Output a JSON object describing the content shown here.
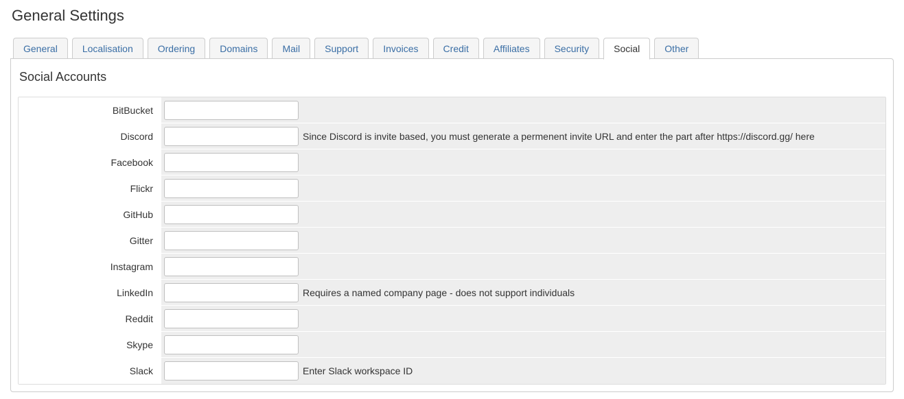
{
  "page_title": "General Settings",
  "tabs": [
    {
      "key": "general",
      "label": "General",
      "active": false
    },
    {
      "key": "localisation",
      "label": "Localisation",
      "active": false
    },
    {
      "key": "ordering",
      "label": "Ordering",
      "active": false
    },
    {
      "key": "domains",
      "label": "Domains",
      "active": false
    },
    {
      "key": "mail",
      "label": "Mail",
      "active": false
    },
    {
      "key": "support",
      "label": "Support",
      "active": false
    },
    {
      "key": "invoices",
      "label": "Invoices",
      "active": false
    },
    {
      "key": "credit",
      "label": "Credit",
      "active": false
    },
    {
      "key": "affiliates",
      "label": "Affiliates",
      "active": false
    },
    {
      "key": "security",
      "label": "Security",
      "active": false
    },
    {
      "key": "social",
      "label": "Social",
      "active": true
    },
    {
      "key": "other",
      "label": "Other",
      "active": false
    }
  ],
  "section_title": "Social Accounts",
  "fields": [
    {
      "key": "bitbucket",
      "label": "BitBucket",
      "value": "",
      "hint": ""
    },
    {
      "key": "discord",
      "label": "Discord",
      "value": "",
      "hint": "Since Discord is invite based, you must generate a permenent invite URL and enter the part after https://discord.gg/ here"
    },
    {
      "key": "facebook",
      "label": "Facebook",
      "value": "",
      "hint": ""
    },
    {
      "key": "flickr",
      "label": "Flickr",
      "value": "",
      "hint": ""
    },
    {
      "key": "github",
      "label": "GitHub",
      "value": "",
      "hint": ""
    },
    {
      "key": "gitter",
      "label": "Gitter",
      "value": "",
      "hint": ""
    },
    {
      "key": "instagram",
      "label": "Instagram",
      "value": "",
      "hint": ""
    },
    {
      "key": "linkedin",
      "label": "LinkedIn",
      "value": "",
      "hint": "Requires a named company page - does not support individuals"
    },
    {
      "key": "reddit",
      "label": "Reddit",
      "value": "",
      "hint": ""
    },
    {
      "key": "skype",
      "label": "Skype",
      "value": "",
      "hint": ""
    },
    {
      "key": "slack",
      "label": "Slack",
      "value": "",
      "hint": "Enter Slack workspace ID"
    }
  ]
}
